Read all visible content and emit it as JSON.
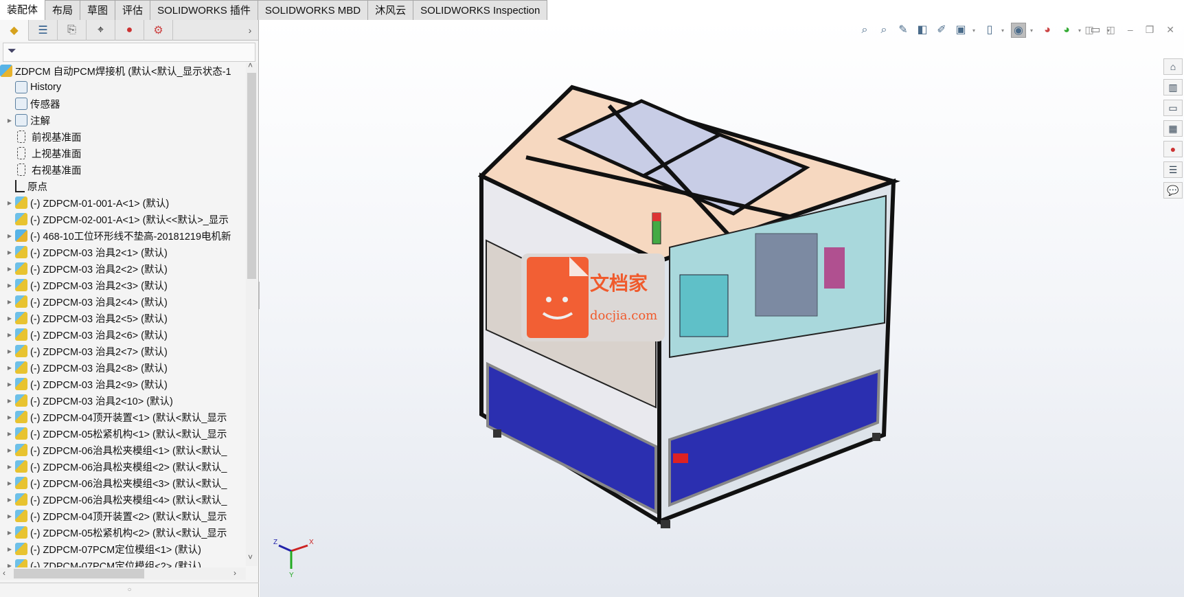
{
  "tabs": [
    "装配体",
    "布局",
    "草图",
    "评估",
    "SOLIDWORKS 插件",
    "SOLIDWORKS MBD",
    "沐风云",
    "SOLIDWORKS Inspection"
  ],
  "panel_tabs": [
    "featuremanager-icon",
    "propertymanager-icon",
    "configurationmanager-icon",
    "dimxpert-icon",
    "appearance-icon",
    "cam-icon"
  ],
  "tree": [
    {
      "label": "ZDPCM 自动PCM焊接机  (默认<默认_显示状态-1",
      "icon": "top",
      "arrow": false,
      "indent": 0
    },
    {
      "label": "History",
      "icon": "folder",
      "arrow": false,
      "indent": 1
    },
    {
      "label": "传感器",
      "icon": "folder",
      "arrow": false,
      "indent": 1
    },
    {
      "label": "注解",
      "icon": "folder",
      "arrow": true,
      "indent": 1
    },
    {
      "label": "前视基准面",
      "icon": "plane",
      "arrow": false,
      "indent": 1
    },
    {
      "label": "上视基准面",
      "icon": "plane",
      "arrow": false,
      "indent": 1
    },
    {
      "label": "右视基准面",
      "icon": "plane",
      "arrow": false,
      "indent": 1
    },
    {
      "label": "原点",
      "icon": "origin",
      "arrow": false,
      "indent": 1
    },
    {
      "label": "(-) ZDPCM-01-001-A<1> (默认)",
      "icon": "asm",
      "arrow": true,
      "indent": 1
    },
    {
      "label": "(-) ZDPCM-02-001-A<1> (默认<<默认>_显示",
      "icon": "asm",
      "arrow": false,
      "indent": 1
    },
    {
      "label": "(-) 468-10工位环形线不垫高-20181219电机新",
      "icon": "top",
      "arrow": true,
      "indent": 1
    },
    {
      "label": "(-) ZDPCM-03 治具2<1> (默认)",
      "icon": "asm",
      "arrow": true,
      "indent": 1
    },
    {
      "label": "(-) ZDPCM-03 治具2<2> (默认)",
      "icon": "asm",
      "arrow": true,
      "indent": 1
    },
    {
      "label": "(-) ZDPCM-03 治具2<3> (默认)",
      "icon": "asm",
      "arrow": true,
      "indent": 1
    },
    {
      "label": "(-) ZDPCM-03 治具2<4> (默认)",
      "icon": "asm",
      "arrow": true,
      "indent": 1
    },
    {
      "label": "(-) ZDPCM-03 治具2<5> (默认)",
      "icon": "asm",
      "arrow": true,
      "indent": 1
    },
    {
      "label": "(-) ZDPCM-03 治具2<6> (默认)",
      "icon": "asm",
      "arrow": true,
      "indent": 1
    },
    {
      "label": "(-) ZDPCM-03 治具2<7> (默认)",
      "icon": "asm",
      "arrow": true,
      "indent": 1
    },
    {
      "label": "(-) ZDPCM-03 治具2<8> (默认)",
      "icon": "asm",
      "arrow": true,
      "indent": 1
    },
    {
      "label": "(-) ZDPCM-03 治具2<9> (默认)",
      "icon": "asm",
      "arrow": true,
      "indent": 1
    },
    {
      "label": "(-) ZDPCM-03 治具2<10> (默认)",
      "icon": "asm",
      "arrow": true,
      "indent": 1
    },
    {
      "label": "(-) ZDPCM-04顶开装置<1> (默认<默认_显示",
      "icon": "asm",
      "arrow": true,
      "indent": 1
    },
    {
      "label": "(-) ZDPCM-05松紧机构<1> (默认<默认_显示",
      "icon": "asm",
      "arrow": true,
      "indent": 1
    },
    {
      "label": "(-) ZDPCM-06治具松夹模组<1> (默认<默认_",
      "icon": "asm",
      "arrow": true,
      "indent": 1
    },
    {
      "label": "(-) ZDPCM-06治具松夹模组<2> (默认<默认_",
      "icon": "asm",
      "arrow": true,
      "indent": 1
    },
    {
      "label": "(-) ZDPCM-06治具松夹模组<3> (默认<默认_",
      "icon": "asm",
      "arrow": true,
      "indent": 1
    },
    {
      "label": "(-) ZDPCM-06治具松夹模组<4> (默认<默认_",
      "icon": "asm",
      "arrow": true,
      "indent": 1
    },
    {
      "label": "(-) ZDPCM-04顶开装置<2> (默认<默认_显示",
      "icon": "asm",
      "arrow": true,
      "indent": 1
    },
    {
      "label": "(-) ZDPCM-05松紧机构<2> (默认<默认_显示",
      "icon": "asm",
      "arrow": true,
      "indent": 1
    },
    {
      "label": "(-) ZDPCM-07PCM定位模组<1> (默认)",
      "icon": "asm",
      "arrow": true,
      "indent": 1
    },
    {
      "label": "(-) ZDPCM-07PCM定位模组<2> (默认)",
      "icon": "asm",
      "arrow": true,
      "indent": 1
    }
  ],
  "heads_up_toolbar": [
    "zoom-to-fit-icon",
    "zoom-to-area-icon",
    "previous-view-icon",
    "section-view-icon",
    "dynamic-annotation-icon",
    "view-orientation-icon",
    "display-style-icon",
    "hide-show-items-icon",
    "edit-appearance-icon",
    "apply-scene-icon",
    "view-settings-icon"
  ],
  "task_pane": [
    "home-icon",
    "design-library-icon",
    "file-explorer-icon",
    "view-palette-icon",
    "appearances-icon",
    "custom-properties-icon",
    "forum-icon"
  ],
  "watermark": {
    "title": "文档家",
    "url": "docjia.com"
  },
  "triad": {
    "x": "X",
    "y": "Y",
    "z": "Z"
  },
  "colors": {
    "panel_top": "#f6d8c0",
    "panel_blue": "#c8cde6",
    "cabinet": "#2b2fb0",
    "frame": "#111111",
    "watermark": "#f25f34"
  }
}
